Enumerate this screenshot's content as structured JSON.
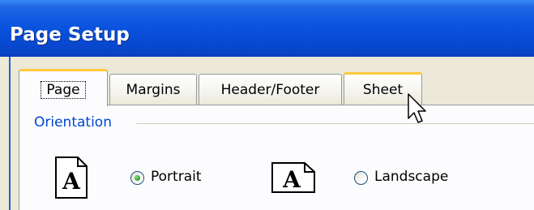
{
  "window": {
    "title": "Page Setup"
  },
  "tabs": [
    {
      "label": "Page",
      "state": "selected"
    },
    {
      "label": "Margins",
      "state": "normal"
    },
    {
      "label": "Header/Footer",
      "state": "normal"
    },
    {
      "label": "Sheet",
      "state": "hover"
    }
  ],
  "orientation": {
    "group_label": "Orientation",
    "portrait": {
      "label": "Portrait",
      "selected": true,
      "icon": "portrait-page-icon",
      "glyph": "A"
    },
    "landscape": {
      "label": "Landscape",
      "selected": false,
      "icon": "landscape-page-icon",
      "glyph": "A"
    }
  },
  "colors": {
    "titlebar": "#0a54df",
    "dialog_bg": "#ece9d8",
    "tab_highlight": "#ffc83c",
    "group_label": "#0046d5",
    "radio_selected": "#21a121"
  },
  "cursor": {
    "icon": "arrow-cursor-icon"
  }
}
